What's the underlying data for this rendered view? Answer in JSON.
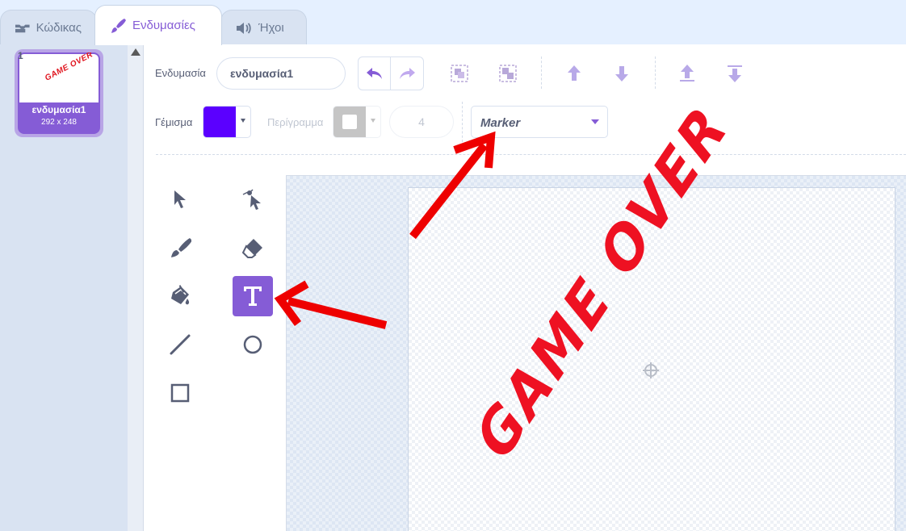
{
  "tabs": [
    {
      "label": "Κώδικας",
      "icon": "code-blocks-icon"
    },
    {
      "label": "Ενδυμασίες",
      "icon": "paintbrush-icon",
      "active": true
    },
    {
      "label": "Ήχοι",
      "icon": "speaker-icon"
    }
  ],
  "costume_list": [
    {
      "index": "1",
      "name": "ενδυμασία1",
      "size": "292 x 248",
      "thumbnail_text": "GAME OVER"
    }
  ],
  "toolbar": {
    "costume_label": "Ενδυμασία",
    "costume_name": "ενδυμασία1",
    "fill_label": "Γέμισμα",
    "fill_color": "#5b00ff",
    "outline_label": "Περίγραμμα",
    "outline_color": "#a0a0a0",
    "outline_width": "4",
    "font": "Marker"
  },
  "tools": [
    {
      "name": "select",
      "icon": "select-arrow-icon"
    },
    {
      "name": "reshape",
      "icon": "reshape-icon"
    },
    {
      "name": "brush",
      "icon": "brush-icon"
    },
    {
      "name": "eraser",
      "icon": "eraser-icon"
    },
    {
      "name": "fill",
      "icon": "fill-bucket-icon"
    },
    {
      "name": "text",
      "icon": "text-icon",
      "selected": true
    },
    {
      "name": "line",
      "icon": "line-icon"
    },
    {
      "name": "circle",
      "icon": "circle-icon"
    },
    {
      "name": "rectangle",
      "icon": "rectangle-icon"
    }
  ],
  "canvas": {
    "text": "GAME OVER",
    "text_color": "#ee1122"
  },
  "colors": {
    "accent": "#855cd6",
    "annotation_arrow": "#ee0000"
  }
}
